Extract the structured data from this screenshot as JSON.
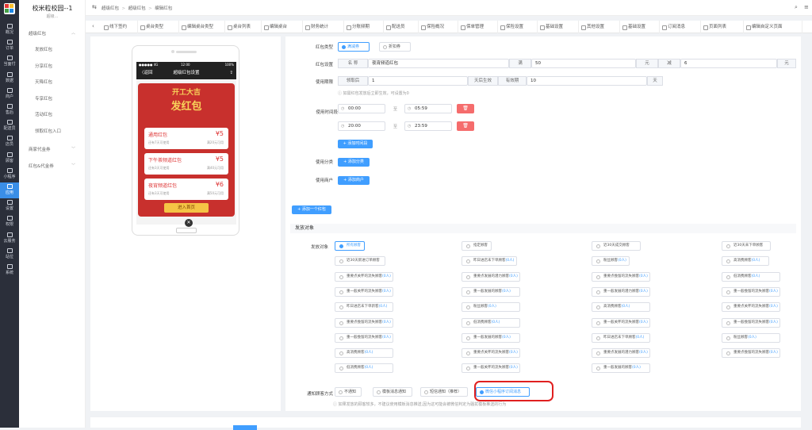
{
  "nav": {
    "items": [
      {
        "label": "概况",
        "name": "overview"
      },
      {
        "label": "订单",
        "name": "orders"
      },
      {
        "label": "当面付",
        "name": "face-pay"
      },
      {
        "label": "数据",
        "name": "data"
      },
      {
        "label": "商户",
        "name": "merchants"
      },
      {
        "label": "售后",
        "name": "after-sales"
      },
      {
        "label": "配送员",
        "name": "couriers"
      },
      {
        "label": "店员",
        "name": "clerks"
      },
      {
        "label": "顾客",
        "name": "customers"
      },
      {
        "label": "小程序",
        "name": "mini-program"
      },
      {
        "label": "应用",
        "name": "apps"
      },
      {
        "label": "设置",
        "name": "settings"
      },
      {
        "label": "权限",
        "name": "permissions"
      },
      {
        "label": "云服务",
        "name": "cloud"
      },
      {
        "label": "站位",
        "name": "station"
      },
      {
        "label": "系统",
        "name": "system"
      }
    ]
  },
  "sidebar": {
    "title": "校米粒校园--1",
    "subtitle": "超级...",
    "group1": "超级红包",
    "items": [
      "发放红包",
      "分享红包",
      "天降红包",
      "专享红包",
      "活动红包",
      "领取红包入口"
    ],
    "group2": "商家代金券",
    "group3": "红包&代金券"
  },
  "header": {
    "breadcrumb": [
      "超级红包",
      "超级红包",
      "编辑红包"
    ]
  },
  "tabs": [
    "线下签约",
    "桌台类型",
    "编辑桌台类型",
    "桌台列表",
    "编辑桌台",
    "财务统计",
    "分账频期",
    "配送员",
    "保险概况",
    "保单管理",
    "保险设置",
    "基础设置",
    "其他设置",
    "基础设置",
    "订阅消息",
    "页面列表",
    "编辑自定义页面"
  ],
  "phone": {
    "status_left": "●●●●● 4G",
    "status_mid": "12:00",
    "status_right": "100%",
    "nav_back": "〈返回",
    "nav_title": "超级红包设置",
    "poster_title1": "开工大吉",
    "poster_title2": "发红包",
    "coupons": [
      {
        "name": "通用红包",
        "value": "¥5",
        "note1": "还有7天可使用",
        "note2": "满20元可用"
      },
      {
        "name": "下午茶频道红包",
        "value": "¥5",
        "note1": "还有3天可使用",
        "note2": "满40元可用"
      },
      {
        "name": "夜宵频道红包",
        "value": "¥6",
        "note1": "还有3天可使用",
        "note2": "满50元可用"
      }
    ],
    "enter_button": "进入首页",
    "close": "✕"
  },
  "form": {
    "type_label": "红包类型",
    "type_options": [
      "满减券",
      "折扣券"
    ],
    "setting_label": "红包设置",
    "name_addon": "名 称",
    "name_value": "夜宵频道红包",
    "full_addon": "满",
    "full_value": "50",
    "yuan1": "元",
    "minus_addon": "减",
    "minus_value": "6",
    "yuan2": "元",
    "period_label": "使用期限",
    "recv_addon": "领取后",
    "recv_value": "1",
    "effective_addon": "天后生效",
    "valid_addon": "有效期",
    "valid_value": "10",
    "day_addon": "天",
    "period_tip": "如需红包发放后立即生效，可设置为0",
    "time_label": "使用时间段",
    "time_rows": [
      {
        "start": "00:00",
        "to": "至",
        "end": "05:59"
      },
      {
        "start": "20:00",
        "to": "至",
        "end": "23:59"
      }
    ],
    "add_time_btn": "+ 添加时间段",
    "category_label": "使用分类",
    "add_category_btn": "+ 添加分类",
    "merchant_label": "使用商户",
    "add_merchant_btn": "+ 添加商户",
    "add_redpack_btn": "+ 添加一个红包",
    "section_title": "发放对象",
    "target_label": "发放对象",
    "targets": [
      {
        "text": "所有顾客",
        "cnt": "",
        "checked": true
      },
      {
        "text": "指定顾客",
        "cnt": ""
      },
      {
        "text": "近30天成交顾客",
        "cnt": ""
      },
      {
        "text": "近30天未下单顾客",
        "cnt": ""
      },
      {
        "text": "近30天新进订单顾客",
        "cnt": ""
      },
      {
        "text": "昨日进店未下单顾客",
        "cnt": "(0人)"
      },
      {
        "text": "粉丝顾客",
        "cnt": "(0人)"
      },
      {
        "text": "高消费顾客",
        "cnt": "(0人)"
      },
      {
        "text": "重要点关怀的流失顾客",
        "cnt": "(0人)"
      },
      {
        "text": "重要点发展的潜力顾客",
        "cnt": "(0人)"
      },
      {
        "text": "重要点挽留的流失顾客",
        "cnt": "(0人)"
      },
      {
        "text": "低消费顾客",
        "cnt": "(0人)"
      },
      {
        "text": "重一般关怀的流失顾客",
        "cnt": "(0人)"
      },
      {
        "text": "重一般发展的顾客",
        "cnt": "(0人)"
      },
      {
        "text": "重一般发展的潜力顾客",
        "cnt": "(0人)"
      },
      {
        "text": "重一般挽留的流失顾客",
        "cnt": "(0人)"
      },
      {
        "text": "昨日进店未下单新客",
        "cnt": "(0人)"
      },
      {
        "text": "粉丝顾客",
        "cnt": "(0人)"
      },
      {
        "text": "高消费顾客",
        "cnt": "(0人)"
      },
      {
        "text": "重要点关怀的流失顾客",
        "cnt": "(0人)"
      },
      {
        "text": "重要点挽留的流失顾客",
        "cnt": "(0人)"
      },
      {
        "text": "低消费顾客",
        "cnt": "(0人)"
      },
      {
        "text": "重一般关怀的流失顾客",
        "cnt": "(0人)"
      },
      {
        "text": "重一般挽留的流失顾客",
        "cnt": "(0人)"
      },
      {
        "text": "重一般挽留的流失顾客",
        "cnt": "(0人)"
      },
      {
        "text": "重一般发展的顾客",
        "cnt": "(0人)"
      },
      {
        "text": "昨日进店未下单顾客",
        "cnt": "(0人)"
      },
      {
        "text": "粉丝顾客",
        "cnt": "(0人)"
      },
      {
        "text": "高消费顾客",
        "cnt": "(0人)"
      },
      {
        "text": "重要点关怀的流失顾客",
        "cnt": "(0人)"
      },
      {
        "text": "重要点发展的潜力顾客",
        "cnt": "(0人)"
      },
      {
        "text": "重要点挽留的流失顾客",
        "cnt": "(0人)"
      },
      {
        "text": "低消费顾客",
        "cnt": "(0人)"
      },
      {
        "text": "重一般关怀的流失顾客",
        "cnt": "(0人)"
      },
      {
        "text": "重一般发展的顾客",
        "cnt": "(0人)"
      }
    ],
    "notify_label": "通知顾客方式",
    "notify_options": [
      "不通知",
      "模板消息通知",
      "短信通知（推荐）",
      "微信小程序订阅消息"
    ],
    "notify_tip": "如果发放的顾客较多，不建议使用模板消息推送,因为这可能会被微信判定为骚扰模板推送的行为"
  }
}
